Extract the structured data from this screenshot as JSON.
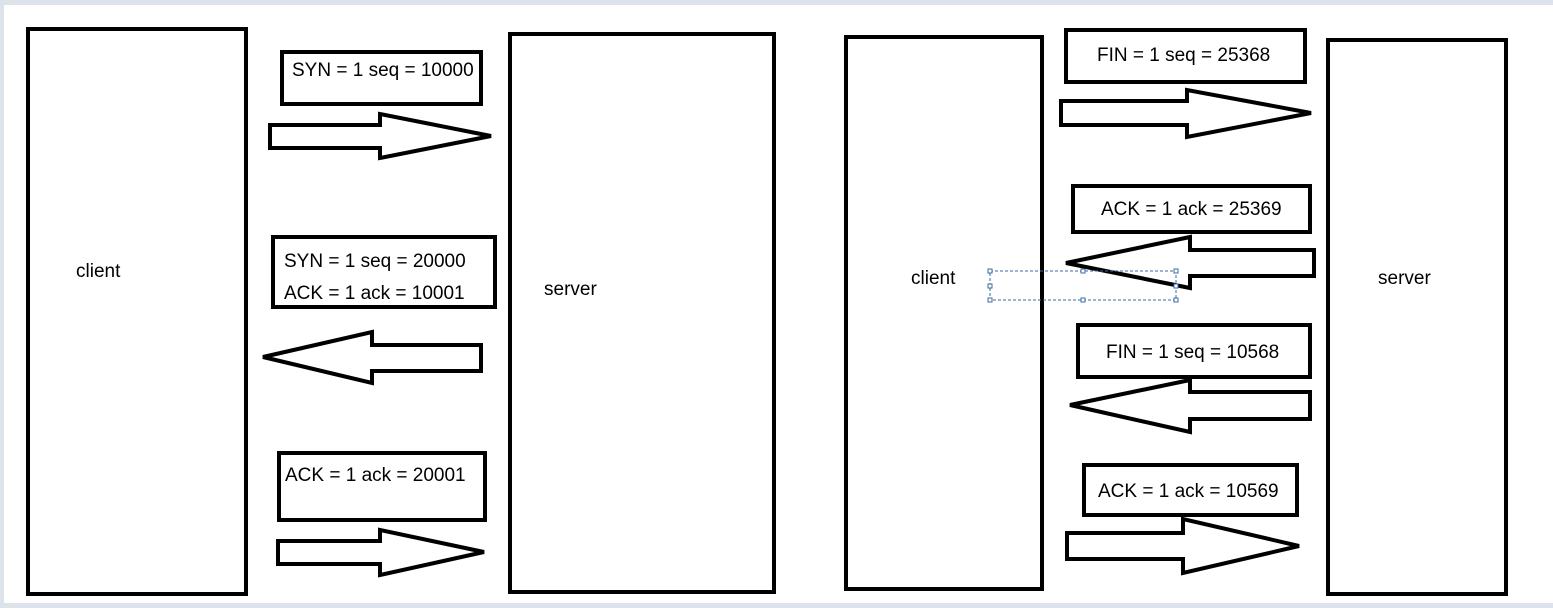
{
  "handshake": {
    "client_label": "client",
    "server_label": "server",
    "msg1": "SYN = 1 seq = 10000",
    "msg2_line1": "SYN = 1 seq = 20000",
    "msg2_line2": "ACK = 1 ack = 10001",
    "msg3": "ACK = 1 ack = 20001"
  },
  "teardown": {
    "client_label": "client",
    "server_label": "server",
    "msg1": "FIN = 1 seq = 25368",
    "msg2": "ACK = 1 ack = 25369",
    "msg3": "FIN = 1 seq = 10568",
    "msg4": "ACK = 1 ack = 10569"
  },
  "colors": {
    "stroke": "#000000",
    "selection": "#3a6ea5",
    "background": "#ffffff",
    "frame": "#dde3ea"
  }
}
